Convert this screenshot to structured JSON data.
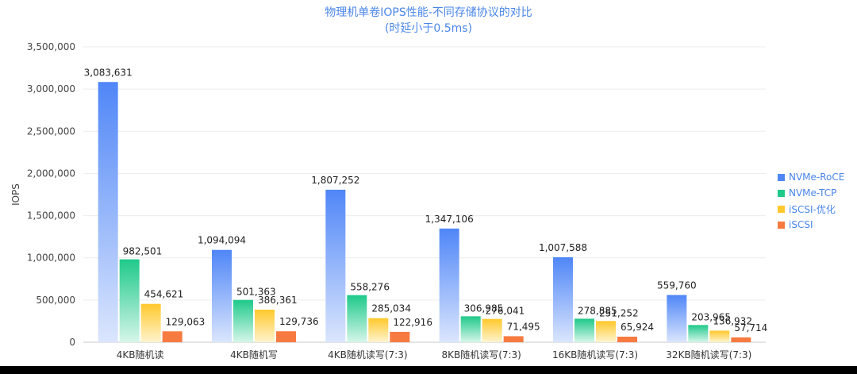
{
  "chart_data": {
    "type": "bar",
    "title": "物理机单卷IOPS性能-不同存储协议的对比",
    "subtitle": "(时延小于0.5ms)",
    "ylabel": "IOPS",
    "xlabel": "",
    "ylim": [
      0,
      3500000
    ],
    "yticks": [
      "0",
      "500,000",
      "1,000,000",
      "1,500,000",
      "2,000,000",
      "2,500,000",
      "3,000,000",
      "3,500,000"
    ],
    "ytick_values": [
      0,
      500000,
      1000000,
      1500000,
      2000000,
      2500000,
      3000000,
      3500000
    ],
    "grid": true,
    "legend_position": "right",
    "categories": [
      "4KB随机读",
      "4KB随机写",
      "4KB随机读写(7:3)",
      "8KB随机读写(7:3)",
      "16KB随机读写(7:3)",
      "32KB随机读写(7:3)"
    ],
    "series": [
      {
        "name": "NVMe-RoCE",
        "color": "#4f86f7",
        "light": "#dbe6fd",
        "values": [
          3083631,
          1094094,
          1807252,
          1347106,
          1007588,
          559760
        ],
        "labels": [
          "3,083,631",
          "1,094,094",
          "1,807,252",
          "1,347,106",
          "1,007,588",
          "559,760"
        ]
      },
      {
        "name": "NVMe-TCP",
        "color": "#1fc98a",
        "light": "#d6f6ea",
        "values": [
          982501,
          501363,
          558276,
          306985,
          278885,
          203965
        ],
        "labels": [
          "982,501",
          "501,363",
          "558,276",
          "306,985",
          "278,885",
          "203,965"
        ]
      },
      {
        "name": "iSCSI-优化",
        "color": "#ffc82c",
        "light": "#fff4cf",
        "values": [
          454621,
          386361,
          285034,
          276041,
          251252,
          136932
        ],
        "labels": [
          "454,621",
          "386,361",
          "285,034",
          "276,041",
          "251,252",
          "136,932"
        ]
      },
      {
        "name": "iSCSI",
        "color": "#f77a40",
        "light": "#f77a40",
        "values": [
          129063,
          129736,
          122916,
          71495,
          65924,
          57714
        ],
        "labels": [
          "129,063",
          "129,736",
          "122,916",
          "71,495",
          "65,924",
          "57,714"
        ]
      }
    ]
  }
}
